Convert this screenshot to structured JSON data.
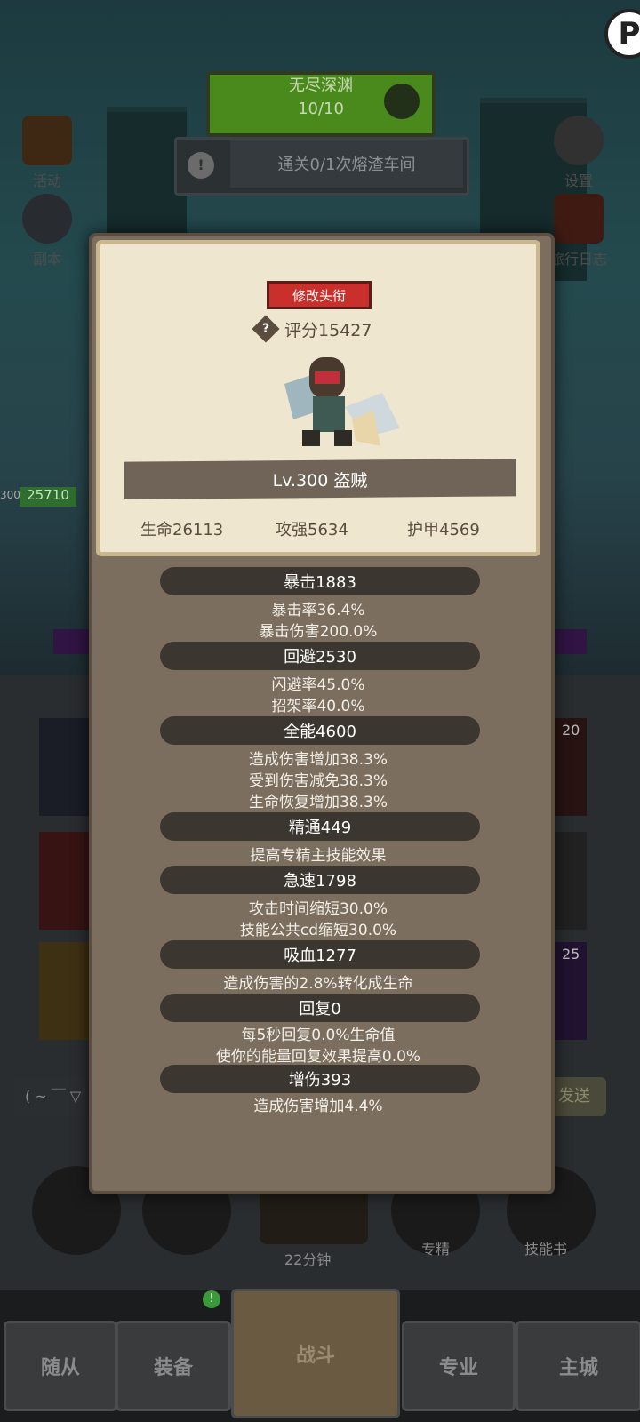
{
  "top": {
    "abyss_title": "无尽深渊",
    "abyss_progress": "10/10",
    "quest_text": "通关0/1次熔渣车间"
  },
  "side_left": [
    "活动",
    "副本"
  ],
  "side_right": [
    "设置",
    "旅行日志"
  ],
  "hud": {
    "hp_left": "300",
    "hp_value": "25710",
    "chat_left": "( ~ ￣ ▽",
    "chat_right": "发送",
    "badge_20": "20",
    "badge_25": "25"
  },
  "quick_bar": {
    "chest_timer": "22分钟",
    "specialize": "专精",
    "skill_book": "技能书"
  },
  "nav": [
    "随从",
    "装备",
    "战斗",
    "专业",
    "主城"
  ],
  "panel": {
    "rename_label": "修改头衔",
    "score_label": "评分15427",
    "level_label": "Lv.300 盗贼",
    "core": [
      "生命26113",
      "攻强5634",
      "护甲4569"
    ],
    "stats": [
      {
        "head": "暴击1883",
        "lines": [
          "暴击率36.4%",
          "暴击伤害200.0%"
        ]
      },
      {
        "head": "回避2530",
        "lines": [
          "闪避率45.0%",
          "招架率40.0%"
        ]
      },
      {
        "head": "全能4600",
        "lines": [
          "造成伤害增加38.3%",
          "受到伤害减免38.3%",
          "生命恢复增加38.3%"
        ]
      },
      {
        "head": "精通449",
        "lines": [
          "提高专精主技能效果"
        ]
      },
      {
        "head": "急速1798",
        "lines": [
          "攻击时间缩短30.0%",
          "技能公共cd缩短30.0%"
        ]
      },
      {
        "head": "吸血1277",
        "lines": [
          "造成伤害的2.8%转化成生命"
        ]
      },
      {
        "head": "回复0",
        "lines": [
          "每5秒回复0.0%生命值",
          "使你的能量回复效果提高0.0%"
        ]
      },
      {
        "head": "增伤393",
        "lines": [
          "造成伤害增加4.4%"
        ]
      }
    ]
  },
  "colors": {
    "accent_red": "#c9302c",
    "panel_bg": "#7c6e5e",
    "card_bg": "#efe6cf"
  }
}
